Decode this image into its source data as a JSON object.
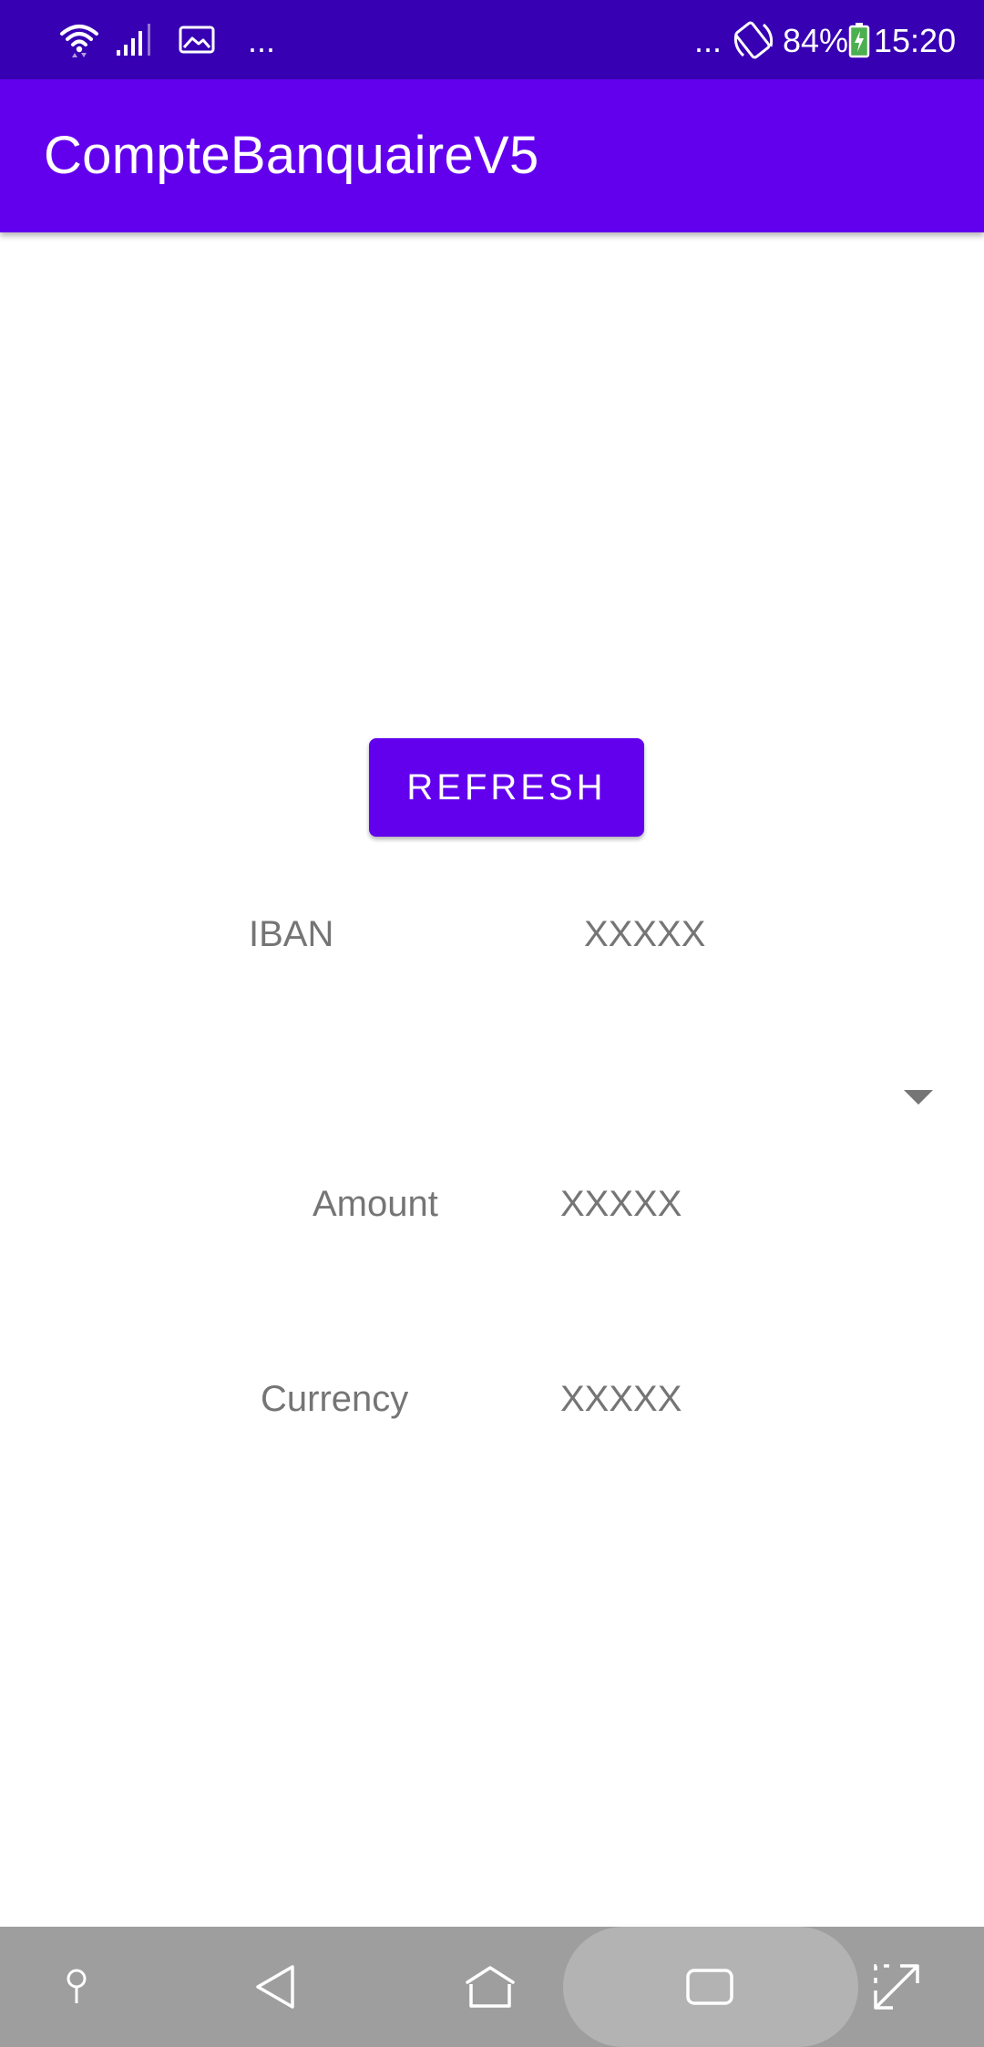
{
  "status_bar": {
    "icons": [
      "wifi-icon",
      "signal-icon",
      "image-icon",
      "more-notifications-icon",
      "more-notifications-icon",
      "rotate-icon",
      "battery-charging-icon"
    ],
    "notification_dots_left": "...",
    "notification_dots_right": "...",
    "battery_percent": "84%",
    "time": "15:20"
  },
  "app_bar": {
    "title": "CompteBanquaireV5"
  },
  "main": {
    "refresh_label": "REFRESH",
    "spinner_icon": "dropdown-arrow-icon",
    "fields": {
      "iban_label": "IBAN",
      "iban_value": "XXXXX",
      "amount_label": "Amount",
      "amount_value": "XXXXX",
      "currency_label": "Currency",
      "currency_value": "XXXXX"
    }
  },
  "nav_bar": {
    "icons": [
      "pin-icon",
      "back-icon",
      "home-icon",
      "recents-icon",
      "expand-icon"
    ]
  },
  "colors": {
    "status_bar": "#3700b3",
    "primary": "#6200ee",
    "text_secondary": "#757575",
    "nav_bar": "#9e9e9e",
    "nav_pill": "#b3b3b3",
    "battery_fill": "#4caf50"
  }
}
